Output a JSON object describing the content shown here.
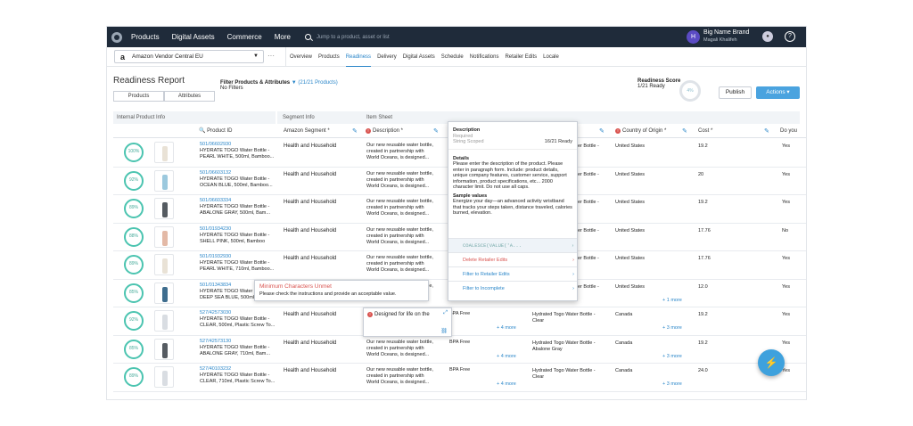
{
  "nav": {
    "items": [
      "Products",
      "Digital Assets",
      "Commerce",
      "More"
    ],
    "search_placeholder": "Jump to a product, asset or list",
    "user_initial": "H",
    "user_name": "Big Name Brand",
    "user_sub": "Magali Khalifeh",
    "help": "?"
  },
  "subnav": {
    "retailer": "Amazon Vendor Central EU",
    "tabs": [
      "Overview",
      "Products",
      "Readiness",
      "Delivery",
      "Digital Assets",
      "Schedule",
      "Notifications",
      "Retailer Edits",
      "Locale"
    ],
    "active_tab": "Readiness"
  },
  "report": {
    "title": "Readiness Report",
    "btn_products": "Products",
    "btn_attributes": "Attributes",
    "filter_title": "Filter Products & Attributes",
    "filter_count": "(21/21 Products)",
    "filter_sub": "No Filters",
    "score_title": "Readiness Score",
    "score_sub": "1/21 Ready",
    "score_pct": "4%",
    "publish": "Publish",
    "actions": "Actions"
  },
  "table": {
    "groups": [
      "Internal Product Info",
      "Segment Info",
      "Item Sheet"
    ],
    "columns": {
      "pid": "Product ID",
      "seg": "Amazon Segment",
      "desc": "Description",
      "coo": "Country of Origin",
      "cost": "Cost",
      "doyou": "Do you"
    },
    "rows": [
      {
        "pct": "100%",
        "id": "501/06602930",
        "name": "HYDRATE TOGO Water Bottle -",
        "name2": "PEARL WHITE, 500ml, Bamboo...",
        "seg": "Health and Household",
        "d1": "Our new reusable water bottle,",
        "d2": "created in partnership with",
        "d3": "World Oceans, is designed...",
        "coo": "United States",
        "cost": "19.2",
        "yes": "Yes",
        "c": "#e9e2d6"
      },
      {
        "pct": "92%",
        "id": "501/06603132",
        "name": "HYDRATE TOGO Water Bottle -",
        "name2": "OCEAN BLUE, 500ml, Bamboo...",
        "seg": "Health and Household",
        "d1": "Our new reusable water bottle,",
        "d2": "created in partnership with",
        "d3": "World Oceans, is designed...",
        "coo": "United States",
        "cost": "20",
        "yes": "Yes",
        "c": "#9cc9de"
      },
      {
        "pct": "89%",
        "id": "501/06603334",
        "name": "HYDRATE TOGO Water Bottle -",
        "name2": "ABALONE GRAY, 500ml, Bam...",
        "seg": "Health and Household",
        "d1": "Our new reusable water bottle,",
        "d2": "created in partnership with",
        "d3": "World Oceans, is designed...",
        "coo": "United States",
        "cost": "19.2",
        "yes": "Yes",
        "c": "#555b61"
      },
      {
        "pct": "88%",
        "id": "501/01934230",
        "name": "HYDRATE TOGO Water Bottle -",
        "name2": "SHELL PINK, 500ml, Bamboo",
        "seg": "Health and Household",
        "d1": "Our new reusable water bottle,",
        "d2": "created in partnership with",
        "d3": "World Oceans, is designed...",
        "coo": "United States",
        "cost": "17.76",
        "yes": "No",
        "c": "#e3b9a6"
      },
      {
        "pct": "89%",
        "id": "501/01932930",
        "name": "HYDRATE TOGO Water Bottle -",
        "name2": "PEARL WHITE, 710ml, Bamboo...",
        "seg": "Health and Household",
        "d1": "Our new reusable water bottle,",
        "d2": "created in partnership with",
        "d3": "World Oceans, is designed...",
        "coo": "United States",
        "cost": "17.76",
        "yes": "Yes",
        "c": "#e9e2d6"
      },
      {
        "pct": "85%",
        "id": "501/01343834",
        "name": "HYDRATE TOGO Water Bottle -",
        "name2": "DEEP SEA BLUE, 500ml",
        "seg": "Health and Household",
        "d1": "Our new reusable water bottle,",
        "d2": "created in partnership with",
        "d3": "World Oceans, is designed...",
        "coo": "United States",
        "cost": "12.0",
        "yes": "Yes",
        "c": "#3e6d8e"
      },
      {
        "pct": "92%",
        "id": "527/42573030",
        "name": "HYDRATE TOGO Water Bottle -",
        "name2": "CLEAR, 500ml, Plastic Screw To...",
        "seg": "Health and Household",
        "d1": "",
        "d2": "",
        "d3": "",
        "coo": "Canada",
        "cost": "19.2",
        "yes": "Yes",
        "c": "#d9dde2"
      },
      {
        "pct": "85%",
        "id": "527/42573130",
        "name": "HYDRATE TOGO Water Bottle -",
        "name2": "ABALONE GRAY, 710ml, Bam...",
        "seg": "Health and Household",
        "d1": "Our new reusable water bottle,",
        "d2": "created in partnership with",
        "d3": "World Oceans, is designed...",
        "coo": "Canada",
        "cost": "19.2",
        "yes": "Yes",
        "c": "#555b61"
      },
      {
        "pct": "89%",
        "id": "527/40103232",
        "name": "HYDRATE TOGO Water Bottle -",
        "name2": "CLEAR, 710ml, Plastic Screw To...",
        "seg": "Health and Household",
        "d1": "Our new reusable water bottle,",
        "d2": "created in partnership with",
        "d3": "World Oceans, is designed...",
        "coo": "Canada",
        "cost": "24.0",
        "yes": "Yes",
        "c": "#d9dde2"
      }
    ],
    "hidden_col_text": "er Bottle -",
    "bpa": "BPA Free",
    "hydrate_clear": "Hydrated Togo Water Bottle -",
    "clear": "Clear",
    "abalone": "Abalone Gray",
    "more1": "+ 1 more",
    "more3": "+ 3 more",
    "more4": "+ 4 more"
  },
  "popover": {
    "title": "Description",
    "required": "Required",
    "string": "String Scoped",
    "count": "16/21 Ready",
    "details_h": "Details",
    "details": "Please enter the description of the product. Please enter in paragraph form. Include: product details, unique company features, customer service, support information, product specifications, etc... 2000 character limit. Do not use all caps.",
    "sample_h": "Sample values",
    "sample": "Energize your day—an advanced activity wristband that tracks your steps taken, distance traveled, calories burned, elevation.",
    "menu": [
      "COALESCE(VALUE('A...",
      "Delete Retailer Edits",
      "Filter to Retailer Edits",
      "Filter to Incomplete"
    ]
  },
  "tooltip": {
    "title": "Minimum Characters Unmet",
    "msg": "Please check the instructions and provide an acceptable value."
  },
  "cell_edit": {
    "value": "Designed for life on the"
  }
}
